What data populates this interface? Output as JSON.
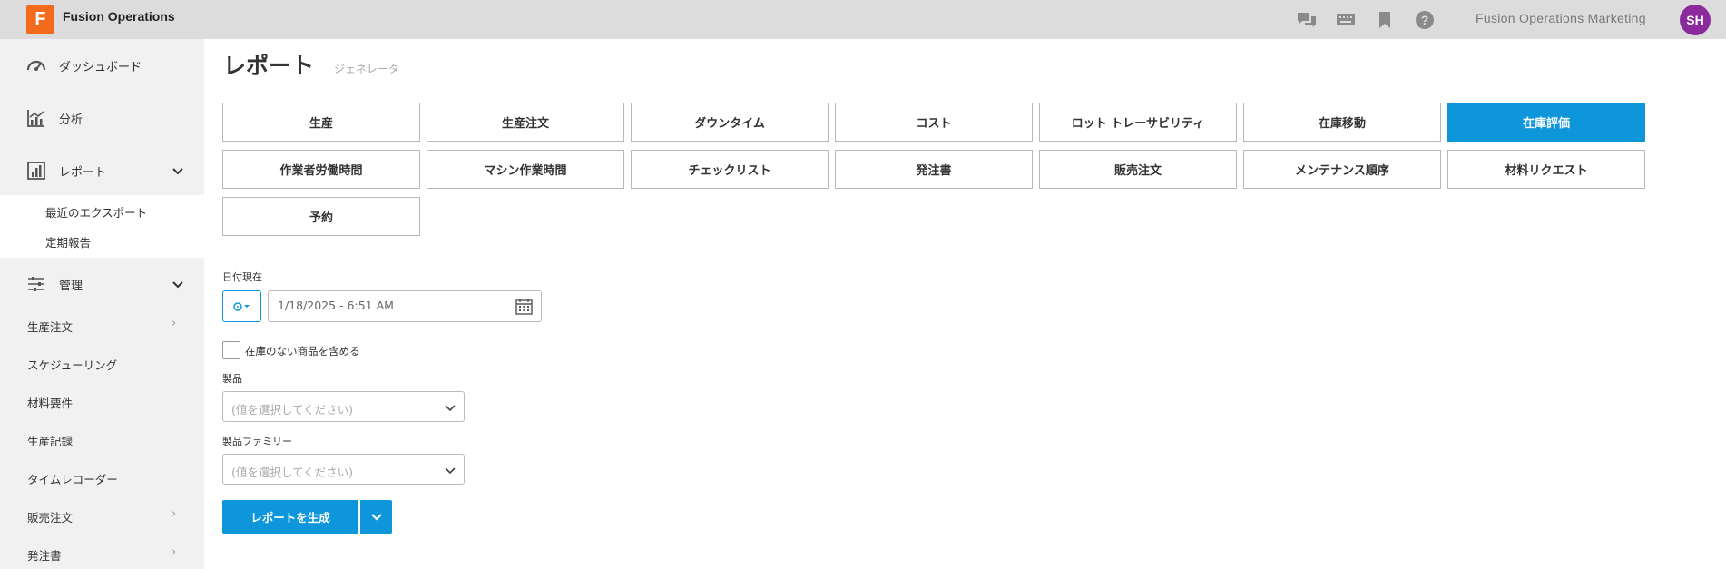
{
  "app": {
    "logo_letter": "F",
    "title": "Fusion Operations",
    "org_name": "Fusion Operations Marketing",
    "avatar_initials": "SH",
    "accent_color": "#0d96d9",
    "logo_color": "#f26a1b",
    "avatar_color": "#8a2a9d",
    "top_icons": [
      "chat-icon",
      "keyboard-icon",
      "bookmark-icon",
      "help-icon"
    ]
  },
  "sidebar": {
    "main": [
      {
        "label": "ダッシュボード",
        "icon": "dashboard-icon"
      },
      {
        "label": "分析",
        "icon": "analytics-icon"
      },
      {
        "label": "レポート",
        "icon": "report-icon",
        "expanded": true
      }
    ],
    "report_sub": [
      "最近のエクスポート",
      "定期報告"
    ],
    "admin": {
      "label": "管理",
      "icon": "sliders-icon",
      "expanded": true
    },
    "admin_items": [
      {
        "label": "生産注文",
        "chevron": true
      },
      {
        "label": "スケジューリング",
        "chevron": false
      },
      {
        "label": "材料要件",
        "chevron": false
      },
      {
        "label": "生産記録",
        "chevron": false
      },
      {
        "label": "タイムレコーダー",
        "chevron": false
      },
      {
        "label": "販売注文",
        "chevron": true
      },
      {
        "label": "発注書",
        "chevron": true
      }
    ]
  },
  "main": {
    "title": "レポート",
    "subtitle": "ジェネレータ",
    "report_types": [
      "生産",
      "生産注文",
      "ダウンタイム",
      "コスト",
      "ロット トレーサビリティ",
      "在庫移動",
      "在庫評価",
      "作業者労働時間",
      "マシン作業時間",
      "チェックリスト",
      "発注書",
      "販売注文",
      "メンテナンス順序",
      "材料リクエスト",
      "予約"
    ],
    "active_report": "在庫評価",
    "date_label": "日付現在",
    "date_value": "1/18/2025 - 6:51 AM",
    "include_out_of_stock_label": "在庫のない商品を含める",
    "include_out_of_stock_checked": false,
    "product_label": "製品",
    "product_placeholder": "(値を選択してください)",
    "family_label": "製品ファミリー",
    "family_placeholder": "(値を選択してください)",
    "generate_label": "レポートを生成"
  }
}
